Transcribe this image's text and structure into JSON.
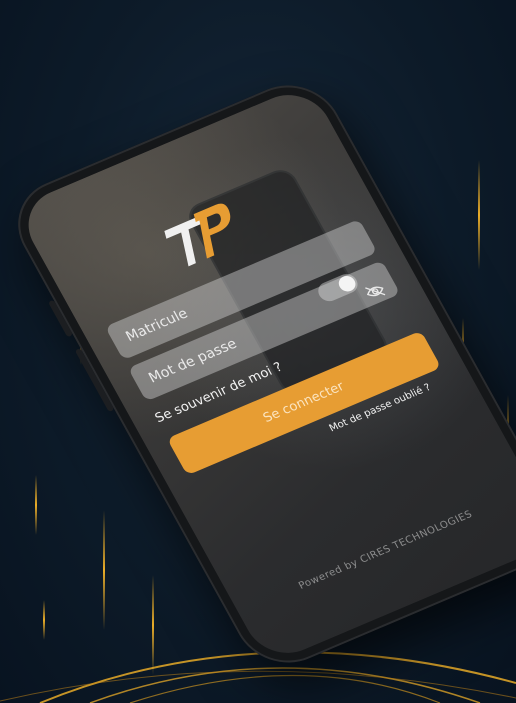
{
  "login": {
    "matricule_placeholder": "Matricule",
    "password_placeholder": "Mot de passe",
    "remember_label": "Se souvenir de moi ?",
    "login_button": "Se connecter",
    "forgot_password": "Mot de passe oublié ?",
    "powered_by": "Powered by CIRES TECHNOLOGIES"
  },
  "colors": {
    "accent": "#e79d33",
    "background": "#0d1b29",
    "streak": "#f5b428"
  },
  "icons": [
    "logo",
    "eye-slash-icon"
  ]
}
